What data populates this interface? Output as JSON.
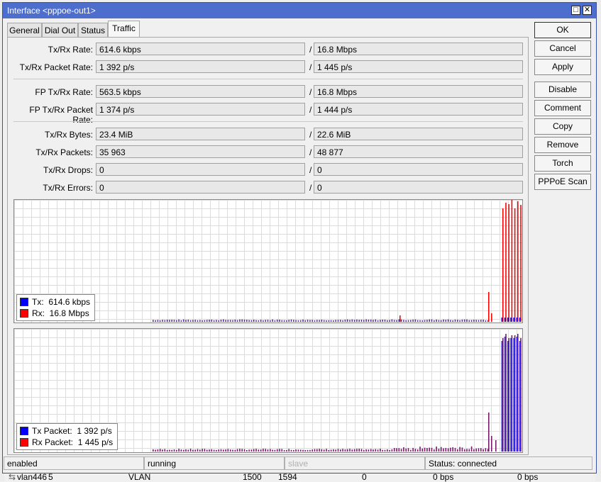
{
  "window": {
    "title": "Interface <pppoe-out1>"
  },
  "tabs": [
    {
      "label": "General"
    },
    {
      "label": "Dial Out"
    },
    {
      "label": "Status"
    },
    {
      "label": "Traffic"
    }
  ],
  "stats": {
    "txrx_rate": {
      "label": "Tx/Rx Rate:",
      "tx": "614.6 kbps",
      "rx": "16.8 Mbps"
    },
    "txrx_packet_rate": {
      "label": "Tx/Rx Packet Rate:",
      "tx": "1 392 p/s",
      "rx": "1 445 p/s"
    },
    "fp_txrx_rate": {
      "label": "FP Tx/Rx Rate:",
      "tx": "563.5 kbps",
      "rx": "16.8 Mbps"
    },
    "fp_txrx_packet_rate": {
      "label": "FP Tx/Rx Packet Rate:",
      "tx": "1 374 p/s",
      "rx": "1 444 p/s"
    },
    "txrx_bytes": {
      "label": "Tx/Rx Bytes:",
      "tx": "23.4 MiB",
      "rx": "22.6 MiB"
    },
    "txrx_packets": {
      "label": "Tx/Rx Packets:",
      "tx": "35 963",
      "rx": "48 877"
    },
    "txrx_drops": {
      "label": "Tx/Rx Drops:",
      "tx": "0",
      "rx": "0"
    },
    "txrx_errors": {
      "label": "Tx/Rx Errors:",
      "tx": "0",
      "rx": "0"
    },
    "separator": "/"
  },
  "graphs": {
    "traffic": {
      "legend": [
        {
          "label": "Tx:",
          "value": "614.6 kbps",
          "color": "#0000ff"
        },
        {
          "label": "Rx:",
          "value": "16.8 Mbps",
          "color": "#ff0000"
        }
      ]
    },
    "packets": {
      "legend": [
        {
          "label": "Tx Packet:",
          "value": "1 392 p/s",
          "color": "#0000ff"
        },
        {
          "label": "Rx Packet:",
          "value": "1 445 p/s",
          "color": "#ff0000"
        }
      ]
    }
  },
  "buttons": [
    "OK",
    "Cancel",
    "Apply",
    "Disable",
    "Comment",
    "Copy",
    "Remove",
    "Torch",
    "PPPoE Scan"
  ],
  "status": {
    "enabled": "enabled",
    "running": "running",
    "slave": "slave",
    "connection": "Status: connected"
  },
  "background_row": {
    "name": "vlan446",
    "number": "5",
    "type": "VLAN",
    "mtu": "1500",
    "l2mtu": "1594",
    "count": "0",
    "tx": "0 bps",
    "rx": "0 bps"
  },
  "colors": {
    "titlebar": "#4d6ecd",
    "tx": "#0000ff",
    "rx": "#ff0000"
  }
}
